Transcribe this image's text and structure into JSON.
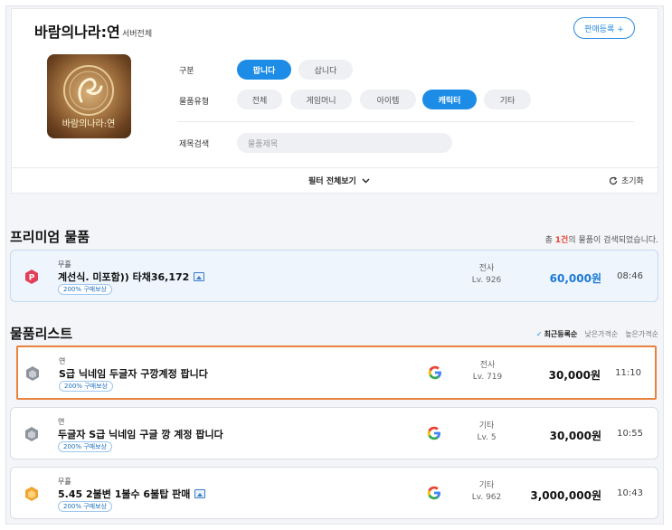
{
  "header": {
    "game_title": "바람의나라:연",
    "server": "서버전체",
    "register_button": "판매등록 +"
  },
  "filters": {
    "type_label": "구분",
    "type_options": [
      "팝니다",
      "삽니다"
    ],
    "type_selected": "팝니다",
    "category_label": "물품유형",
    "category_options": [
      "전체",
      "게임머니",
      "아이템",
      "캐릭터",
      "기타"
    ],
    "category_selected": "캐릭터",
    "search_label": "제목검색",
    "search_placeholder": "물품제목",
    "show_all": "필터 전체보기",
    "reset": "초기화"
  },
  "premium": {
    "section_title": "프리미엄 물품",
    "result_prefix": "총 ",
    "result_count": "1건",
    "result_suffix": "의 물품이 검색되었습니다.",
    "items": [
      {
        "seller": "무휼",
        "title": "계선식. 미포함)) 타채36,172",
        "badge": "200% 구매보상",
        "class_name": "전사",
        "level": "Lv. 926",
        "price": "60,000원",
        "time": "08:46"
      }
    ]
  },
  "list": {
    "section_title": "물품리스트",
    "sort_options": [
      "최근등록순",
      "낮은가격순",
      "높은가격순"
    ],
    "sort_selected": "최근등록순",
    "items": [
      {
        "seller": "연",
        "title": "S급 닉네임 두글자 구깡계정 팝니다",
        "badge": "200% 구매보상",
        "class_name": "전사",
        "level": "Lv. 719",
        "price": "30,000원",
        "time": "11:10"
      },
      {
        "seller": "연",
        "title": "두글자 S급 닉네임 구글 깡 계정 팝니다",
        "badge": "200% 구매보상",
        "class_name": "기타",
        "level": "Lv. 5",
        "price": "30,000원",
        "time": "10:55"
      },
      {
        "seller": "무휼",
        "title": "5.45 2불변 1불수 6불탑 판매",
        "badge": "200% 구매보상",
        "class_name": "기타",
        "level": "Lv. 962",
        "price": "3,000,000원",
        "time": "10:43"
      }
    ]
  },
  "colors": {
    "accent": "#1d8ce6",
    "highlight_border": "#e8823f",
    "count_red": "#e8462f"
  }
}
